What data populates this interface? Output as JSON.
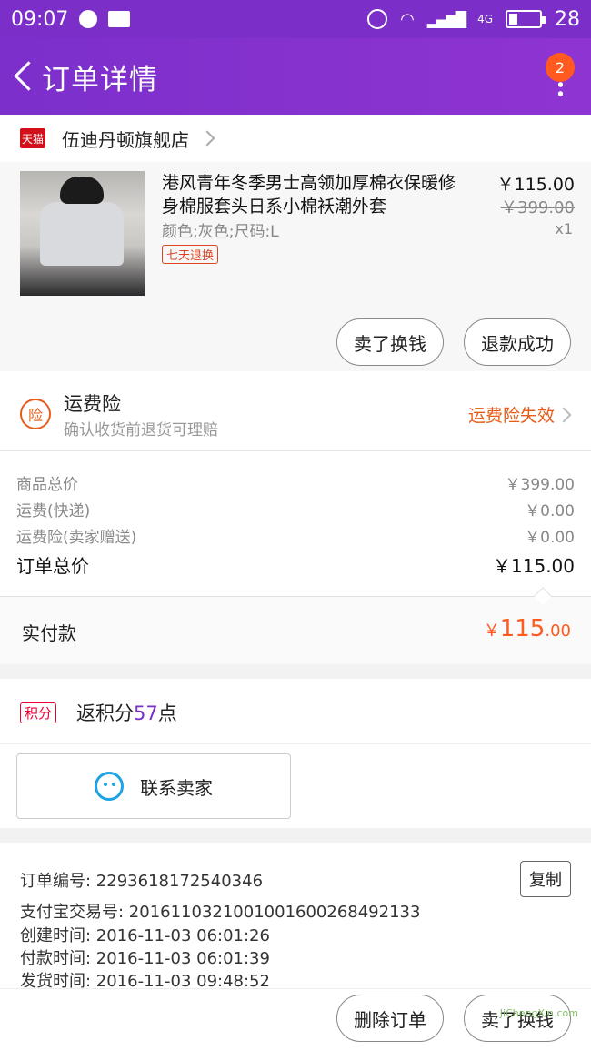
{
  "status_bar": {
    "time": "09:07",
    "network": "4G",
    "battery": "28",
    "battery_level": 0.28
  },
  "navbar": {
    "title": "订单详情",
    "badge_count": "2"
  },
  "shop": {
    "logo_text": "天猫",
    "name": "伍迪丹顿旗舰店"
  },
  "product": {
    "title": "港风青年冬季男士高领加厚棉衣保暖修身棉服套头日系小棉袄潮外套",
    "attributes": "颜色:灰色;尺码:L",
    "tag": "七天退换",
    "price": "￥115.00",
    "original_price": "￥399.00",
    "quantity": "x1",
    "buttons": {
      "sell_swap": "卖了换钱",
      "refund_success": "退款成功"
    }
  },
  "insurance": {
    "icon_text": "险",
    "title": "运费险",
    "subtitle": "确认收货前退货可理赔",
    "status": "运费险失效"
  },
  "summary": {
    "rows": [
      {
        "label": "商品总价",
        "value": "￥399.00"
      },
      {
        "label": "运费(快递)",
        "value": "￥0.00"
      },
      {
        "label": "运费险(卖家赠送)",
        "value": "￥0.00"
      }
    ],
    "total_label": "订单总价",
    "total_value": "￥115.00"
  },
  "payment": {
    "label": "实付款",
    "currency": "￥",
    "amount_int": "115",
    "amount_dec": ".00"
  },
  "points": {
    "tag": "积分",
    "prefix": "返积分",
    "number": "57",
    "suffix": "点"
  },
  "contact": {
    "label": "联系卖家"
  },
  "order_info": {
    "order_no": "订单编号: 2293618172540346",
    "alipay_no": "支付宝交易号: 2016110321001001600268492133",
    "created": "创建时间: 2016-11-03 06:01:26",
    "paid": "付款时间: 2016-11-03 06:01:39",
    "shipped": "发货时间: 2016-11-03 09:48:52",
    "copy_label": "复制"
  },
  "bottom_bar": {
    "delete_label": "删除订单",
    "sell_label": "卖了换钱"
  },
  "watermark": "JiChengXin.com",
  "colors": {
    "brand_purple": "#7b2fc8",
    "accent_orange": "#ff5a1f",
    "tmall_red": "#d1101b"
  }
}
